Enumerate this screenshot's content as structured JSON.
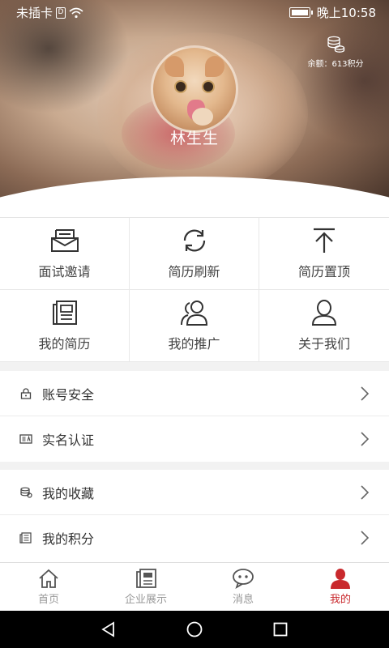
{
  "status_bar": {
    "carrier": "未插卡",
    "time": "晚上10:58"
  },
  "profile": {
    "username": "林生生",
    "balance": "余额：613积分"
  },
  "grid_items": [
    {
      "label": "面试邀请",
      "icon": "inbox-icon"
    },
    {
      "label": "简历刷新",
      "icon": "refresh-icon"
    },
    {
      "label": "简历置顶",
      "icon": "pin-top-icon"
    },
    {
      "label": "我的简历",
      "icon": "resume-icon"
    },
    {
      "label": "我的推广",
      "icon": "users-icon"
    },
    {
      "label": "关于我们",
      "icon": "user-icon"
    }
  ],
  "list_section_1": [
    {
      "label": "账号安全",
      "icon": "lock-icon"
    },
    {
      "label": "实名认证",
      "icon": "id-card-icon"
    }
  ],
  "list_section_2": [
    {
      "label": "我的收藏",
      "icon": "coins-icon"
    },
    {
      "label": "我的积分",
      "icon": "points-icon"
    }
  ],
  "tabs": [
    {
      "label": "首页",
      "icon": "home-icon",
      "active": false
    },
    {
      "label": "企业展示",
      "icon": "book-icon",
      "active": false
    },
    {
      "label": "消息",
      "icon": "chat-icon",
      "active": false
    },
    {
      "label": "我的",
      "icon": "person-icon",
      "active": true
    }
  ],
  "colors": {
    "accent": "#c9292d",
    "inactive": "#999999"
  }
}
